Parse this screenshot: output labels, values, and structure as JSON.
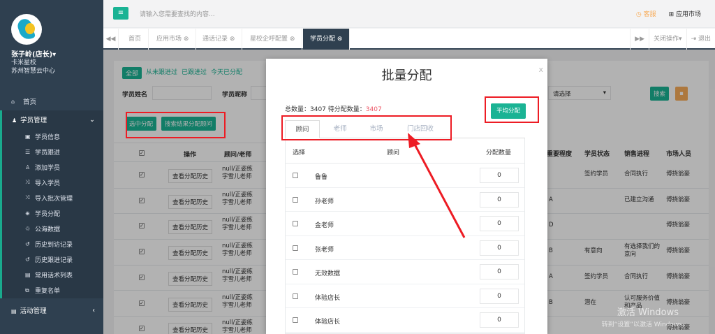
{
  "sidebar": {
    "user_name": "张子岭(店长)▾",
    "school": "卡米星校",
    "org": "苏州智慧云中心",
    "home": "首页",
    "group_label": "学员管理",
    "items": [
      {
        "label": "学员信息",
        "icon": "id-card-icon"
      },
      {
        "label": "学员跟进",
        "icon": "list-icon"
      },
      {
        "label": "添加学员",
        "icon": "user-add-icon"
      },
      {
        "label": "导入学员",
        "icon": "shuffle-icon"
      },
      {
        "label": "导入批次管理",
        "icon": "shuffle-icon"
      },
      {
        "label": "学员分配",
        "icon": "compass-icon"
      },
      {
        "label": "公海数据",
        "icon": "recycle-icon"
      },
      {
        "label": "历史到访记录",
        "icon": "history-icon"
      },
      {
        "label": "历史跟进记录",
        "icon": "history-icon"
      },
      {
        "label": "常用话术列表",
        "icon": "file-icon"
      },
      {
        "label": "重复名单",
        "icon": "copy-icon"
      }
    ],
    "activity": "活动管理"
  },
  "topbar": {
    "menu_icon": "≡",
    "search_placeholder": "请输入您需要查找的内容...",
    "service": "客服",
    "app_market": "应用市场"
  },
  "tabs": [
    "首页",
    "应用市场",
    "通话记录",
    "星校企呼配置",
    "学员分配"
  ],
  "tabs_right": {
    "close_ops": "关闭操作▾",
    "logout": "退出"
  },
  "main": {
    "filter_tabs": [
      "全部",
      "从未跟进过",
      "已跟进过",
      "今天已分配"
    ],
    "student_name_label": "学员姓名",
    "nickname_label": "学员昵称",
    "select_placeholder": "请选择",
    "search_btn": "搜索",
    "btn_assign_selected": "选中分配",
    "btn_assign_search": "搜索结果分配顾问",
    "headers_left": [
      "操作",
      "顾问/老师"
    ],
    "headers_right": [
      "重要程度",
      "学员状态",
      "销售进程",
      "市场人员"
    ],
    "row_btn": "查看分配历史",
    "row_text": [
      "null/正姿练",
      "字雪儿老师"
    ],
    "rows_right": [
      {
        "imp": "",
        "status": "签约学员",
        "progress": "合同执行",
        "market": "博挠翁豪"
      },
      {
        "imp": "A",
        "status": "",
        "progress": "已建立沟通",
        "market": "博挠翁豪"
      },
      {
        "imp": "D",
        "status": "",
        "progress": "",
        "market": "博挠翁豪"
      },
      {
        "imp": "B",
        "status": "有意向",
        "progress": "有选择我们的意向",
        "market": "博挠翁豪"
      },
      {
        "imp": "A",
        "status": "签约学员",
        "progress": "合同执行",
        "market": "博挠翁豪"
      },
      {
        "imp": "B",
        "status": "潜在",
        "progress": "认可服务价值和产品",
        "market": "博挠翁豪"
      },
      {
        "imp": "",
        "status": "",
        "progress": "",
        "market": "博挠翁豪"
      }
    ]
  },
  "modal": {
    "title": "批量分配",
    "close": "x",
    "total_label": "总数量：3407 待分配数量：",
    "pending": "3407",
    "avg_btn": "平均分配",
    "tabs": [
      "顾问",
      "老师",
      "市场",
      "门店回收"
    ],
    "col_select": "选择",
    "col_advisor": "顾问",
    "col_count": "分配数量",
    "rows": [
      {
        "name": "鲁鲁",
        "count": "0"
      },
      {
        "name": "孙老师",
        "count": "0"
      },
      {
        "name": "金老师",
        "count": "0"
      },
      {
        "name": "张老师",
        "count": "0"
      },
      {
        "name": "无效数据",
        "count": "0"
      },
      {
        "name": "体验店长",
        "count": "0"
      },
      {
        "name": "体验店长",
        "count": "0"
      }
    ]
  },
  "watermark": {
    "line1": "激活 Windows",
    "line2": "转到“设置”以激活 Windows。"
  },
  "colors": {
    "sidebar": "#2f4050",
    "accent": "#1ab394",
    "warning": "#f8ac59",
    "danger": "#ed5565",
    "annotation": "#ed1c24"
  }
}
